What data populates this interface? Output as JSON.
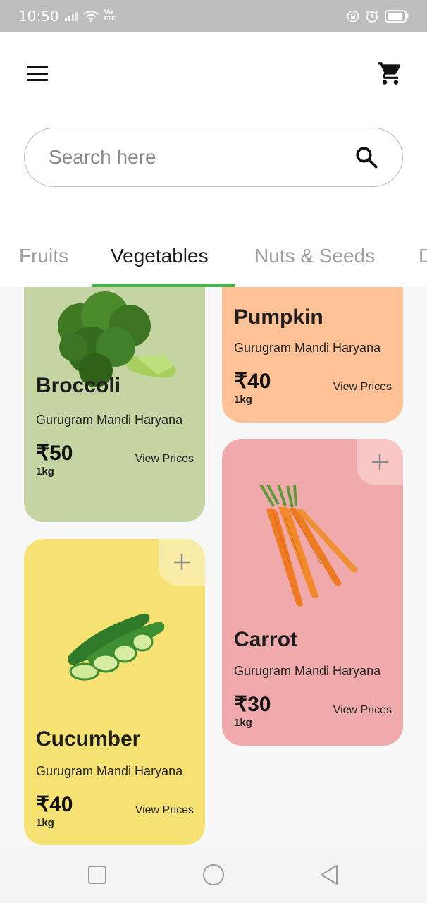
{
  "status_bar": {
    "time": "10:50",
    "network": "Vo LTE"
  },
  "search": {
    "placeholder": "Search here"
  },
  "tabs": [
    {
      "label": "Fruits"
    },
    {
      "label": "Vegetables"
    },
    {
      "label": "Nuts & Seeds"
    },
    {
      "label": "D"
    }
  ],
  "active_tab": "Vegetables",
  "products": [
    {
      "name": "Broccoli",
      "location": "Gurugram Mandi Haryana",
      "price": "₹50",
      "unit": "1kg",
      "action": "View Prices",
      "color": "#c5d4a3"
    },
    {
      "name": "Pumpkin",
      "location": "Gurugram Mandi Haryana",
      "price": "₹40",
      "unit": "1kg",
      "action": "View Prices",
      "color": "#ffc196"
    },
    {
      "name": "Carrot",
      "location": "Gurugram Mandi Haryana",
      "price": "₹30",
      "unit": "1kg",
      "action": "View Prices",
      "color": "#f0aaab"
    },
    {
      "name": "Cucumber",
      "location": "Gurugram Mandi Haryana",
      "price": "₹40",
      "unit": "1kg",
      "action": "View Prices",
      "color": "#f5e272"
    }
  ],
  "icons": {
    "menu": "hamburger-menu-icon",
    "cart": "shopping-cart-icon",
    "search": "search-icon",
    "add": "plus-icon",
    "nav_recents": "square-icon",
    "nav_home": "circle-icon",
    "nav_back": "triangle-back-icon"
  },
  "accent_color": "#4caf50"
}
